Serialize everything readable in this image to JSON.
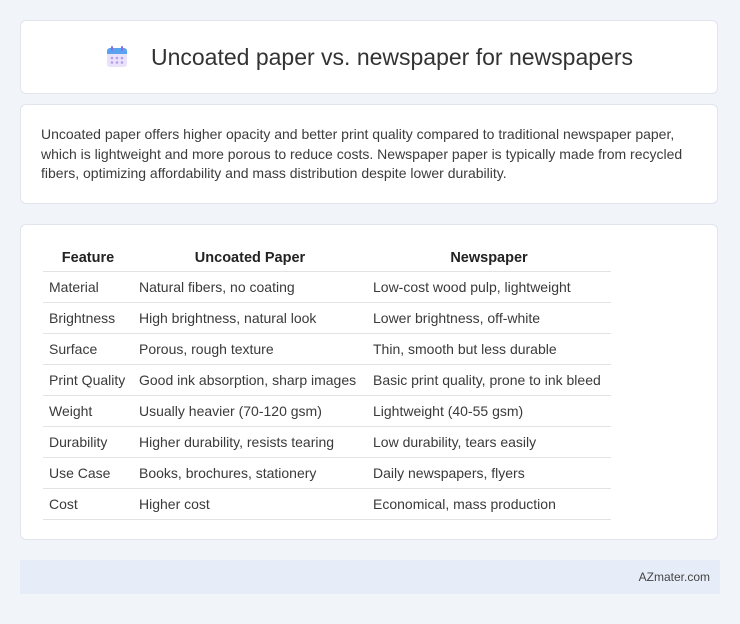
{
  "header": {
    "icon": "calendar-icon",
    "title": "Uncoated paper vs. newspaper for newspapers"
  },
  "description": "Uncoated paper offers higher opacity and better print quality compared to traditional newspaper paper, which is lightweight and more porous to reduce costs. Newspaper paper is typically made from recycled fibers, optimizing affordability and mass distribution despite lower durability.",
  "table": {
    "headers": [
      "Feature",
      "Uncoated Paper",
      "Newspaper"
    ],
    "rows": [
      [
        "Material",
        "Natural fibers, no coating",
        "Low-cost wood pulp, lightweight"
      ],
      [
        "Brightness",
        "High brightness, natural look",
        "Lower brightness, off-white"
      ],
      [
        "Surface",
        "Porous, rough texture",
        "Thin, smooth but less durable"
      ],
      [
        "Print Quality",
        "Good ink absorption, sharp images",
        "Basic print quality, prone to ink bleed"
      ],
      [
        "Weight",
        "Usually heavier (70-120 gsm)",
        "Lightweight (40-55 gsm)"
      ],
      [
        "Durability",
        "Higher durability, resists tearing",
        "Low durability, tears easily"
      ],
      [
        "Use Case",
        "Books, brochures, stationery",
        "Daily newspapers, flyers"
      ],
      [
        "Cost",
        "Higher cost",
        "Economical, mass production"
      ]
    ]
  },
  "footer": {
    "site": "AZmater.com"
  }
}
